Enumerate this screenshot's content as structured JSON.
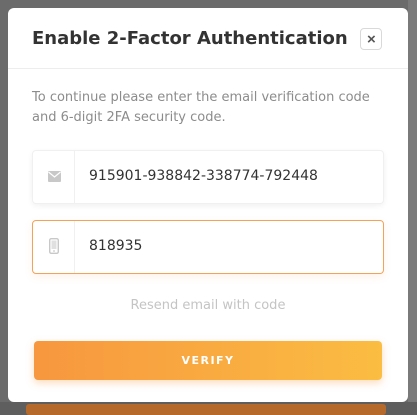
{
  "dialog": {
    "title": "Enable 2-Factor Authentication",
    "close_label": "×",
    "instruction": "To continue please enter the email verification code and 6-digit 2FA security code.",
    "email_code": {
      "icon": "envelope-icon",
      "value": "915901-938842-338774-792448"
    },
    "security_code": {
      "icon": "phone-icon",
      "value": "818935"
    },
    "resend_label": "Resend email with code",
    "verify_label": "VERIFY"
  },
  "colors": {
    "accent_start": "#f7973f",
    "accent_end": "#fbbd42",
    "focus_border": "#f2a35a"
  }
}
